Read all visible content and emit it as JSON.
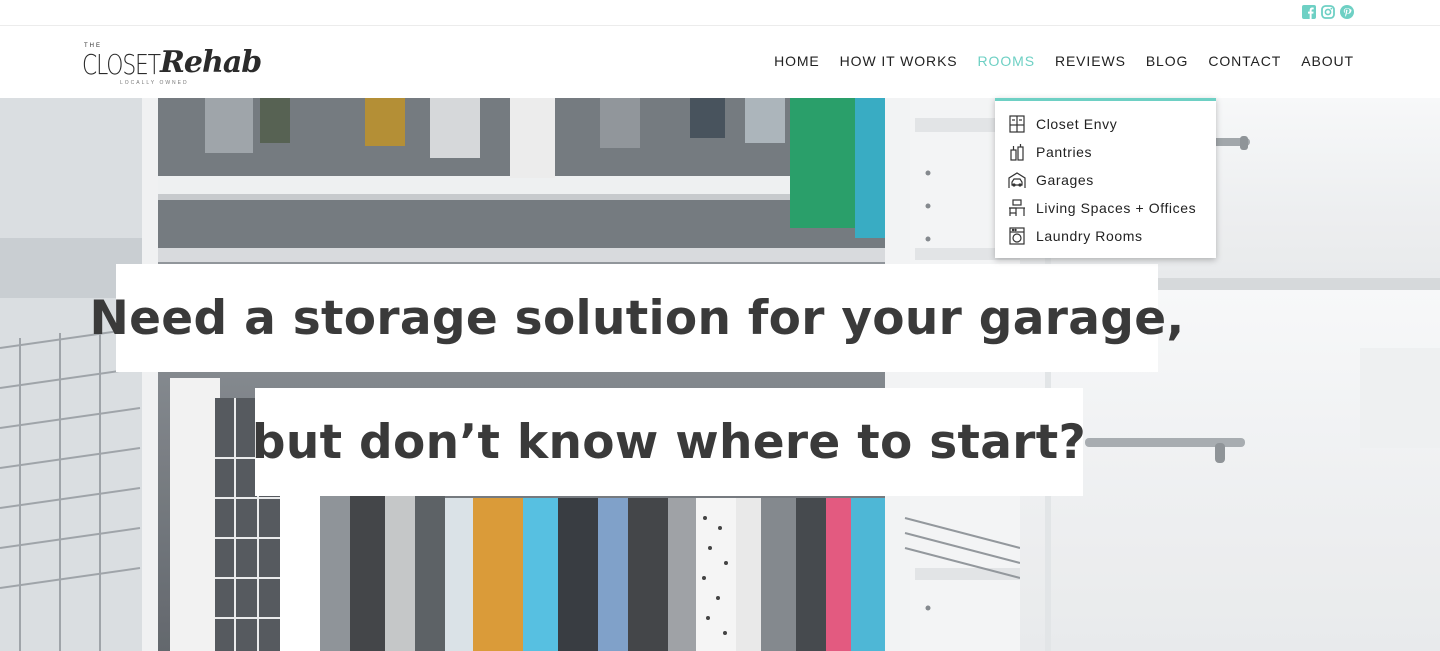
{
  "colors": {
    "accent": "#6ed0c4",
    "headline_text": "#3a3a3a",
    "nav_text": "#222222"
  },
  "social": [
    {
      "icon": "facebook-icon"
    },
    {
      "icon": "instagram-icon"
    },
    {
      "icon": "pinterest-icon"
    }
  ],
  "logo": {
    "top_small": "THE",
    "word1": "CLOSET",
    "word2": "Rehab",
    "tagline": "LOCALLY OWNED"
  },
  "nav": {
    "items": [
      {
        "label": "HOME"
      },
      {
        "label": "HOW IT WORKS"
      },
      {
        "label": "ROOMS",
        "active": true
      },
      {
        "label": "REVIEWS"
      },
      {
        "label": "BLOG"
      },
      {
        "label": "CONTACT"
      },
      {
        "label": "ABOUT"
      }
    ]
  },
  "rooms_menu": {
    "items": [
      {
        "label": "Closet Envy",
        "icon": "closet-icon"
      },
      {
        "label": "Pantries",
        "icon": "bottles-icon"
      },
      {
        "label": "Garages",
        "icon": "garage-car-icon"
      },
      {
        "label": "Living Spaces + Offices",
        "icon": "desk-icon"
      },
      {
        "label": "Laundry Rooms",
        "icon": "washing-machine-icon"
      }
    ]
  },
  "hero": {
    "line1": "Need a storage solution for your garage,",
    "line2": "but don’t know where to start?"
  }
}
